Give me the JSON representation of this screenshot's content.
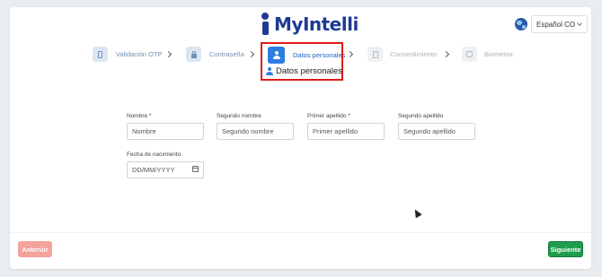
{
  "header": {
    "logo_text": "MyIntelli",
    "language": {
      "icon": "globe-icon",
      "selected": "Español CO"
    }
  },
  "stepper": {
    "steps": [
      {
        "label": "Validación OTP",
        "icon": "phone-icon",
        "state": "done"
      },
      {
        "label": "Contraseña",
        "icon": "lock-icon",
        "state": "done"
      },
      {
        "label": "Datos personales",
        "icon": "user-icon",
        "state": "active"
      },
      {
        "label": "Consentimiento",
        "icon": "document-icon",
        "state": "pending"
      },
      {
        "label": "Biometria",
        "icon": "fingerprint-icon",
        "state": "pending"
      }
    ],
    "current_section": "Datos personales"
  },
  "form": {
    "fields": [
      {
        "label": "Nombre *",
        "placeholder": "Nombre"
      },
      {
        "label": "Segundo nombre",
        "placeholder": "Segundo nombre"
      },
      {
        "label": "Primer apellido *",
        "placeholder": "Primer apellido"
      },
      {
        "label": "Segundo apellido",
        "placeholder": "Segundo apellido"
      },
      {
        "label": "Fecha de nacimiento",
        "placeholder": "DD/MM/YYYY"
      }
    ]
  },
  "footer": {
    "prev_label": "Anterior",
    "next_label": "Siguiente"
  },
  "colors": {
    "brand": "#1f3a93",
    "active_step": "#2f7de1",
    "highlight": "#e01b1b",
    "next_button": "#1f9d4d",
    "prev_button": "#f2a39a"
  }
}
